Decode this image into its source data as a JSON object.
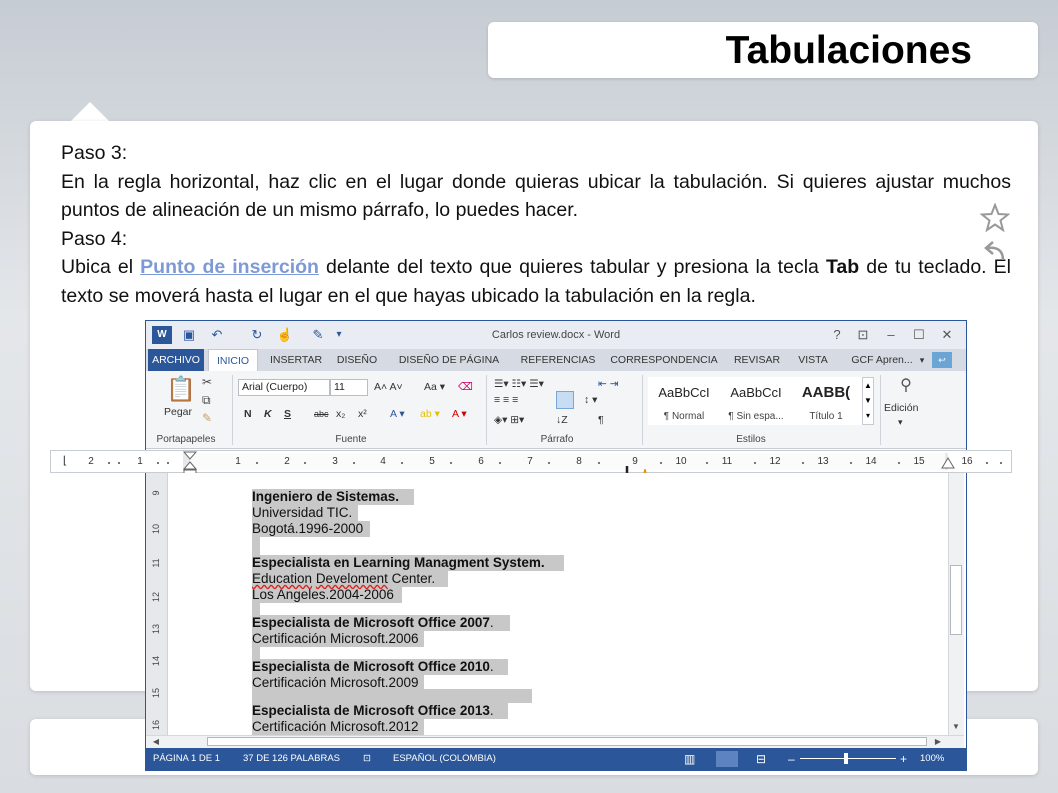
{
  "slide": {
    "title": "Tabulaciones",
    "paso3_label": "Paso 3:",
    "paso3_text": "En la regla horizontal, haz clic en el lugar donde quieras ubicar la tabulación. Si quieres ajustar muchos puntos de alineación de un mismo párrafo, lo puedes hacer.",
    "paso4_label": "Paso 4:",
    "paso4_text_a": "Ubica el ",
    "paso4_link": "Punto de inserción",
    "paso4_text_b": " delante del texto que quieres tabular y presiona la tecla ",
    "paso4_key": "Tab",
    "paso4_text_c": " de tu teclado. El texto se moverá hasta el lugar en el que hayas ubicado la tabulación en la regla."
  },
  "word": {
    "window_title": "Carlos review.docx - Word",
    "window_buttons": [
      "?",
      "⊡",
      "–",
      "☐",
      "✕"
    ],
    "tabs": [
      "ARCHIVO",
      "INICIO",
      "INSERTAR",
      "DISEÑO",
      "DISEÑO DE PÁGINA",
      "REFERENCIAS",
      "CORRESPONDENCIA",
      "REVISAR",
      "VISTA"
    ],
    "account": "GCF Apren...",
    "ribbon": {
      "portapapeles_label": "Portapapeles",
      "pegar_label": "Pegar",
      "fuente_label": "Fuente",
      "font_name": "Arial (Cuerpo)",
      "font_size": "11",
      "parrafo_label": "Párrafo",
      "estilos_label": "Estilos",
      "styles": [
        {
          "sample": "AaBbCcI",
          "name": "¶ Normal"
        },
        {
          "sample": "AaBbCcI",
          "name": "¶ Sin espa..."
        },
        {
          "sample": "AABB(",
          "name": "Título 1"
        }
      ],
      "edicion_label": "Edición",
      "font_buttons": [
        "N",
        "K",
        "S",
        "abc",
        "x₂",
        "x²"
      ]
    },
    "ruler_numbers": [
      "2",
      "1",
      "1",
      "1",
      "2",
      "3",
      "4",
      "5",
      "6",
      "7",
      "8",
      "9",
      "10",
      "11",
      "12",
      "13",
      "14",
      "15",
      "16"
    ],
    "vruler_numbers": [
      "9",
      "10",
      "11",
      "12",
      "13",
      "14",
      "15",
      "16"
    ],
    "document": {
      "entries": [
        {
          "title": "Ingeniero de Sistemas.",
          "line2": "Universidad TIC.",
          "line3": "Bogotá.1996-2000"
        },
        {
          "title": "Especialista en Learning Managment System.",
          "line2a": "Education",
          "line2b": " ",
          "line2c": "Develoment",
          "line2d": " Center.",
          "line3": "Los Angeles.2004-2006"
        },
        {
          "title": "Especialista de Microsoft Office 2007",
          "title_tail": ".",
          "line2": "Certificación Microsoft.2006"
        },
        {
          "title": "Especialista de Microsoft Office 2010",
          "title_tail": ".",
          "line2": "Certificación Microsoft.2009"
        },
        {
          "title": "Especialista de Microsoft Office 2013",
          "title_tail": ".",
          "line2": "Certificación Microsoft.2012"
        }
      ]
    },
    "status": {
      "page": "PÁGINA 1 DE 1",
      "words": "37 DE 126 PALABRAS",
      "language": "ESPAÑOL (COLOMBIA)",
      "zoom": "100%"
    }
  },
  "colors": {
    "word_blue": "#2b579a",
    "link": "#7d9ad6",
    "selection": "#c8c8c8",
    "burst": "#f5b800"
  }
}
